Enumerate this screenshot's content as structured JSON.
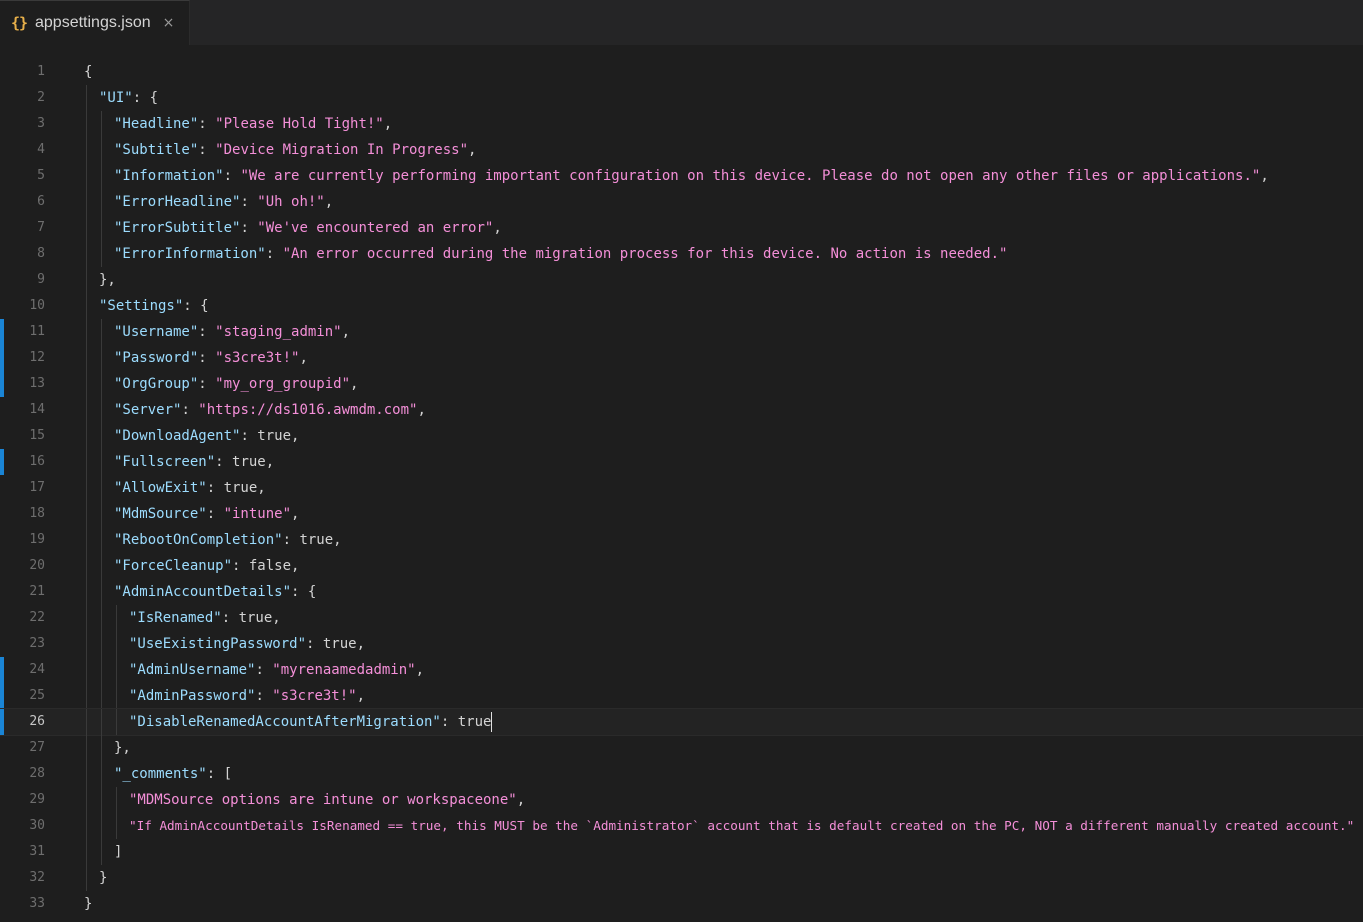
{
  "tab": {
    "icon": "{}",
    "filename": "appsettings.json",
    "close": "×"
  },
  "lines": [
    {
      "n": "1",
      "indent": 0,
      "parts": [
        {
          "t": "{",
          "c": "p"
        }
      ]
    },
    {
      "n": "2",
      "indent": 1,
      "parts": [
        {
          "t": "\"UI\"",
          "c": "k"
        },
        {
          "t": ": {",
          "c": "p"
        }
      ]
    },
    {
      "n": "3",
      "indent": 2,
      "parts": [
        {
          "t": "\"Headline\"",
          "c": "k"
        },
        {
          "t": ": ",
          "c": "p"
        },
        {
          "t": "\"Please Hold Tight!\"",
          "c": "s"
        },
        {
          "t": ",",
          "c": "p"
        }
      ]
    },
    {
      "n": "4",
      "indent": 2,
      "parts": [
        {
          "t": "\"Subtitle\"",
          "c": "k"
        },
        {
          "t": ": ",
          "c": "p"
        },
        {
          "t": "\"Device Migration In Progress\"",
          "c": "s"
        },
        {
          "t": ",",
          "c": "p"
        }
      ]
    },
    {
      "n": "5",
      "indent": 2,
      "parts": [
        {
          "t": "\"Information\"",
          "c": "k"
        },
        {
          "t": ": ",
          "c": "p"
        },
        {
          "t": "\"We are currently performing important configuration on this device. Please do not open any other files or applications.\"",
          "c": "s"
        },
        {
          "t": ",",
          "c": "p"
        }
      ]
    },
    {
      "n": "6",
      "indent": 2,
      "parts": [
        {
          "t": "\"ErrorHeadline\"",
          "c": "k"
        },
        {
          "t": ": ",
          "c": "p"
        },
        {
          "t": "\"Uh oh!\"",
          "c": "s"
        },
        {
          "t": ",",
          "c": "p"
        }
      ]
    },
    {
      "n": "7",
      "indent": 2,
      "parts": [
        {
          "t": "\"ErrorSubtitle\"",
          "c": "k"
        },
        {
          "t": ": ",
          "c": "p"
        },
        {
          "t": "\"We've encountered an error\"",
          "c": "s"
        },
        {
          "t": ",",
          "c": "p"
        }
      ]
    },
    {
      "n": "8",
      "indent": 2,
      "parts": [
        {
          "t": "\"ErrorInformation\"",
          "c": "k"
        },
        {
          "t": ": ",
          "c": "p"
        },
        {
          "t": "\"An error occurred during the migration process for this device. No action is needed.\"",
          "c": "s"
        }
      ]
    },
    {
      "n": "9",
      "indent": 1,
      "parts": [
        {
          "t": "},",
          "c": "p"
        }
      ]
    },
    {
      "n": "10",
      "indent": 1,
      "parts": [
        {
          "t": "\"Settings\"",
          "c": "k"
        },
        {
          "t": ": {",
          "c": "p"
        }
      ]
    },
    {
      "n": "11",
      "indent": 2,
      "mark": true,
      "parts": [
        {
          "t": "\"Username\"",
          "c": "k"
        },
        {
          "t": ": ",
          "c": "p"
        },
        {
          "t": "\"staging_admin\"",
          "c": "s"
        },
        {
          "t": ",",
          "c": "p"
        }
      ]
    },
    {
      "n": "12",
      "indent": 2,
      "mark": true,
      "parts": [
        {
          "t": "\"Password\"",
          "c": "k"
        },
        {
          "t": ": ",
          "c": "p"
        },
        {
          "t": "\"s3cre3t!\"",
          "c": "s"
        },
        {
          "t": ",",
          "c": "p"
        }
      ]
    },
    {
      "n": "13",
      "indent": 2,
      "mark": true,
      "parts": [
        {
          "t": "\"OrgGroup\"",
          "c": "k"
        },
        {
          "t": ": ",
          "c": "p"
        },
        {
          "t": "\"my_org_groupid\"",
          "c": "s"
        },
        {
          "t": ",",
          "c": "p"
        }
      ]
    },
    {
      "n": "14",
      "indent": 2,
      "parts": [
        {
          "t": "\"Server\"",
          "c": "k"
        },
        {
          "t": ": ",
          "c": "p"
        },
        {
          "t": "\"https://ds1016.awmdm.com\"",
          "c": "s"
        },
        {
          "t": ",",
          "c": "p"
        }
      ]
    },
    {
      "n": "15",
      "indent": 2,
      "parts": [
        {
          "t": "\"DownloadAgent\"",
          "c": "k"
        },
        {
          "t": ": ",
          "c": "p"
        },
        {
          "t": "true",
          "c": "b"
        },
        {
          "t": ",",
          "c": "p"
        }
      ]
    },
    {
      "n": "16",
      "indent": 2,
      "mark": true,
      "parts": [
        {
          "t": "\"Fullscreen\"",
          "c": "k"
        },
        {
          "t": ": ",
          "c": "p"
        },
        {
          "t": "true",
          "c": "b"
        },
        {
          "t": ",",
          "c": "p"
        }
      ]
    },
    {
      "n": "17",
      "indent": 2,
      "parts": [
        {
          "t": "\"AllowExit\"",
          "c": "k"
        },
        {
          "t": ": ",
          "c": "p"
        },
        {
          "t": "true",
          "c": "b"
        },
        {
          "t": ",",
          "c": "p"
        }
      ]
    },
    {
      "n": "18",
      "indent": 2,
      "parts": [
        {
          "t": "\"MdmSource\"",
          "c": "k"
        },
        {
          "t": ": ",
          "c": "p"
        },
        {
          "t": "\"intune\"",
          "c": "s"
        },
        {
          "t": ",",
          "c": "p"
        }
      ]
    },
    {
      "n": "19",
      "indent": 2,
      "parts": [
        {
          "t": "\"RebootOnCompletion\"",
          "c": "k"
        },
        {
          "t": ": ",
          "c": "p"
        },
        {
          "t": "true",
          "c": "b"
        },
        {
          "t": ",",
          "c": "p"
        }
      ]
    },
    {
      "n": "20",
      "indent": 2,
      "parts": [
        {
          "t": "\"ForceCleanup\"",
          "c": "k"
        },
        {
          "t": ": ",
          "c": "p"
        },
        {
          "t": "false",
          "c": "b"
        },
        {
          "t": ",",
          "c": "p"
        }
      ]
    },
    {
      "n": "21",
      "indent": 2,
      "parts": [
        {
          "t": "\"AdminAccountDetails\"",
          "c": "k"
        },
        {
          "t": ": {",
          "c": "p"
        }
      ]
    },
    {
      "n": "22",
      "indent": 3,
      "parts": [
        {
          "t": "\"IsRenamed\"",
          "c": "k"
        },
        {
          "t": ": ",
          "c": "p"
        },
        {
          "t": "true",
          "c": "b"
        },
        {
          "t": ",",
          "c": "p"
        }
      ]
    },
    {
      "n": "23",
      "indent": 3,
      "parts": [
        {
          "t": "\"UseExistingPassword\"",
          "c": "k"
        },
        {
          "t": ": ",
          "c": "p"
        },
        {
          "t": "true",
          "c": "b"
        },
        {
          "t": ",",
          "c": "p"
        }
      ]
    },
    {
      "n": "24",
      "indent": 3,
      "mark": true,
      "parts": [
        {
          "t": "\"AdminUsername\"",
          "c": "k"
        },
        {
          "t": ": ",
          "c": "p"
        },
        {
          "t": "\"myrenaamedadmin\"",
          "c": "s"
        },
        {
          "t": ",",
          "c": "p"
        }
      ]
    },
    {
      "n": "25",
      "indent": 3,
      "mark": true,
      "parts": [
        {
          "t": "\"AdminPassword\"",
          "c": "k"
        },
        {
          "t": ": ",
          "c": "p"
        },
        {
          "t": "\"s3cre3t!\"",
          "c": "s"
        },
        {
          "t": ",",
          "c": "p"
        }
      ]
    },
    {
      "n": "26",
      "indent": 3,
      "mark": true,
      "current": true,
      "parts": [
        {
          "t": "\"DisableRenamedAccountAfterMigration\"",
          "c": "k"
        },
        {
          "t": ": ",
          "c": "p"
        },
        {
          "t": "true",
          "c": "b"
        }
      ]
    },
    {
      "n": "27",
      "indent": 2,
      "parts": [
        {
          "t": "},",
          "c": "p"
        }
      ]
    },
    {
      "n": "28",
      "indent": 2,
      "parts": [
        {
          "t": "\"_comments\"",
          "c": "k"
        },
        {
          "t": ": [",
          "c": "p"
        }
      ]
    },
    {
      "n": "29",
      "indent": 3,
      "parts": [
        {
          "t": "\"MDMSource options are intune or workspaceone\"",
          "c": "s"
        },
        {
          "t": ",",
          "c": "p"
        }
      ]
    },
    {
      "n": "30",
      "indent": 3,
      "parts": [
        {
          "t": "\"If AdminAccountDetails IsRenamed == true, this MUST be the `Administrator` account that is default created on the PC, NOT a different manually created account.\"",
          "c": "s"
        }
      ]
    },
    {
      "n": "31",
      "indent": 2,
      "parts": [
        {
          "t": "]",
          "c": "p"
        }
      ]
    },
    {
      "n": "32",
      "indent": 1,
      "parts": [
        {
          "t": "}",
          "c": "p"
        }
      ]
    },
    {
      "n": "33",
      "indent": 0,
      "parts": [
        {
          "t": "}",
          "c": "p"
        }
      ]
    }
  ],
  "colors": {
    "key": "#9cdcfe",
    "string": "#f48fd8",
    "punct": "#d4d4d4",
    "modified_gutter": "#1a85d6",
    "json_icon": "#e8b04a"
  }
}
